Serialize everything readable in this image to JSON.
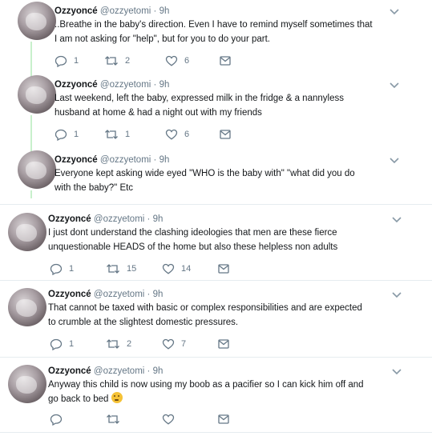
{
  "tweets": [
    {
      "name": "Ozzyoncé",
      "handle": "@ozzyetomi",
      "separator": "·",
      "time": "9h",
      "text_lines": [
        "..Breathe in the baby's direction. Even I have to remind myself sometimes that",
        "I am not asking for \"help\", but for you to do your part."
      ],
      "replies": "1",
      "retweets": "2",
      "likes": "6"
    },
    {
      "name": "Ozzyoncé",
      "handle": "@ozzyetomi",
      "separator": "·",
      "time": "9h",
      "text_lines": [
        "Last weekend, left the baby, expressed milk in the fridge & a nannyless",
        "husband at home & had a night out with my friends"
      ],
      "replies": "1",
      "retweets": "1",
      "likes": "6"
    },
    {
      "name": "Ozzyoncé",
      "handle": "@ozzyetomi",
      "separator": "·",
      "time": "9h",
      "text_lines": [
        "Everyone kept asking wide eyed \"WHO is the baby with\" \"what did you do",
        "with the baby?\" Etc"
      ],
      "replies": "",
      "retweets": "",
      "likes": ""
    },
    {
      "name": "Ozzyoncé",
      "handle": "@ozzyetomi",
      "separator": "·",
      "time": "9h",
      "text_lines": [
        "I just dont understand the clashing ideologies that men are these fierce",
        "unquestionable HEADS of the home but also these helpless non adults"
      ],
      "replies": "1",
      "retweets": "15",
      "likes": "14"
    },
    {
      "name": "Ozzyoncé",
      "handle": "@ozzyetomi",
      "separator": "·",
      "time": "9h",
      "text_lines": [
        "That cannot be taxed with basic or complex responsibilities and are expected",
        "to crumble at the slightest domestic pressures."
      ],
      "replies": "1",
      "retweets": "2",
      "likes": "7"
    },
    {
      "name": "Ozzyoncé",
      "handle": "@ozzyetomi",
      "separator": "·",
      "time": "9h",
      "text_lines": [
        "Anyway this child is now using my boob as a pacifier so I can kick him off and",
        "go back to bed"
      ],
      "replies": "",
      "retweets": "",
      "likes": ""
    }
  ],
  "icons": {
    "reply": "reply-icon",
    "retweet": "retweet-icon",
    "like": "heart-icon",
    "message": "envelope-icon",
    "menu": "chevron-down-icon",
    "emoji": "thinking-face-emoji"
  },
  "colors": {
    "thread_line": "#c8f0cc",
    "muted": "#657786",
    "text": "#14171a"
  }
}
